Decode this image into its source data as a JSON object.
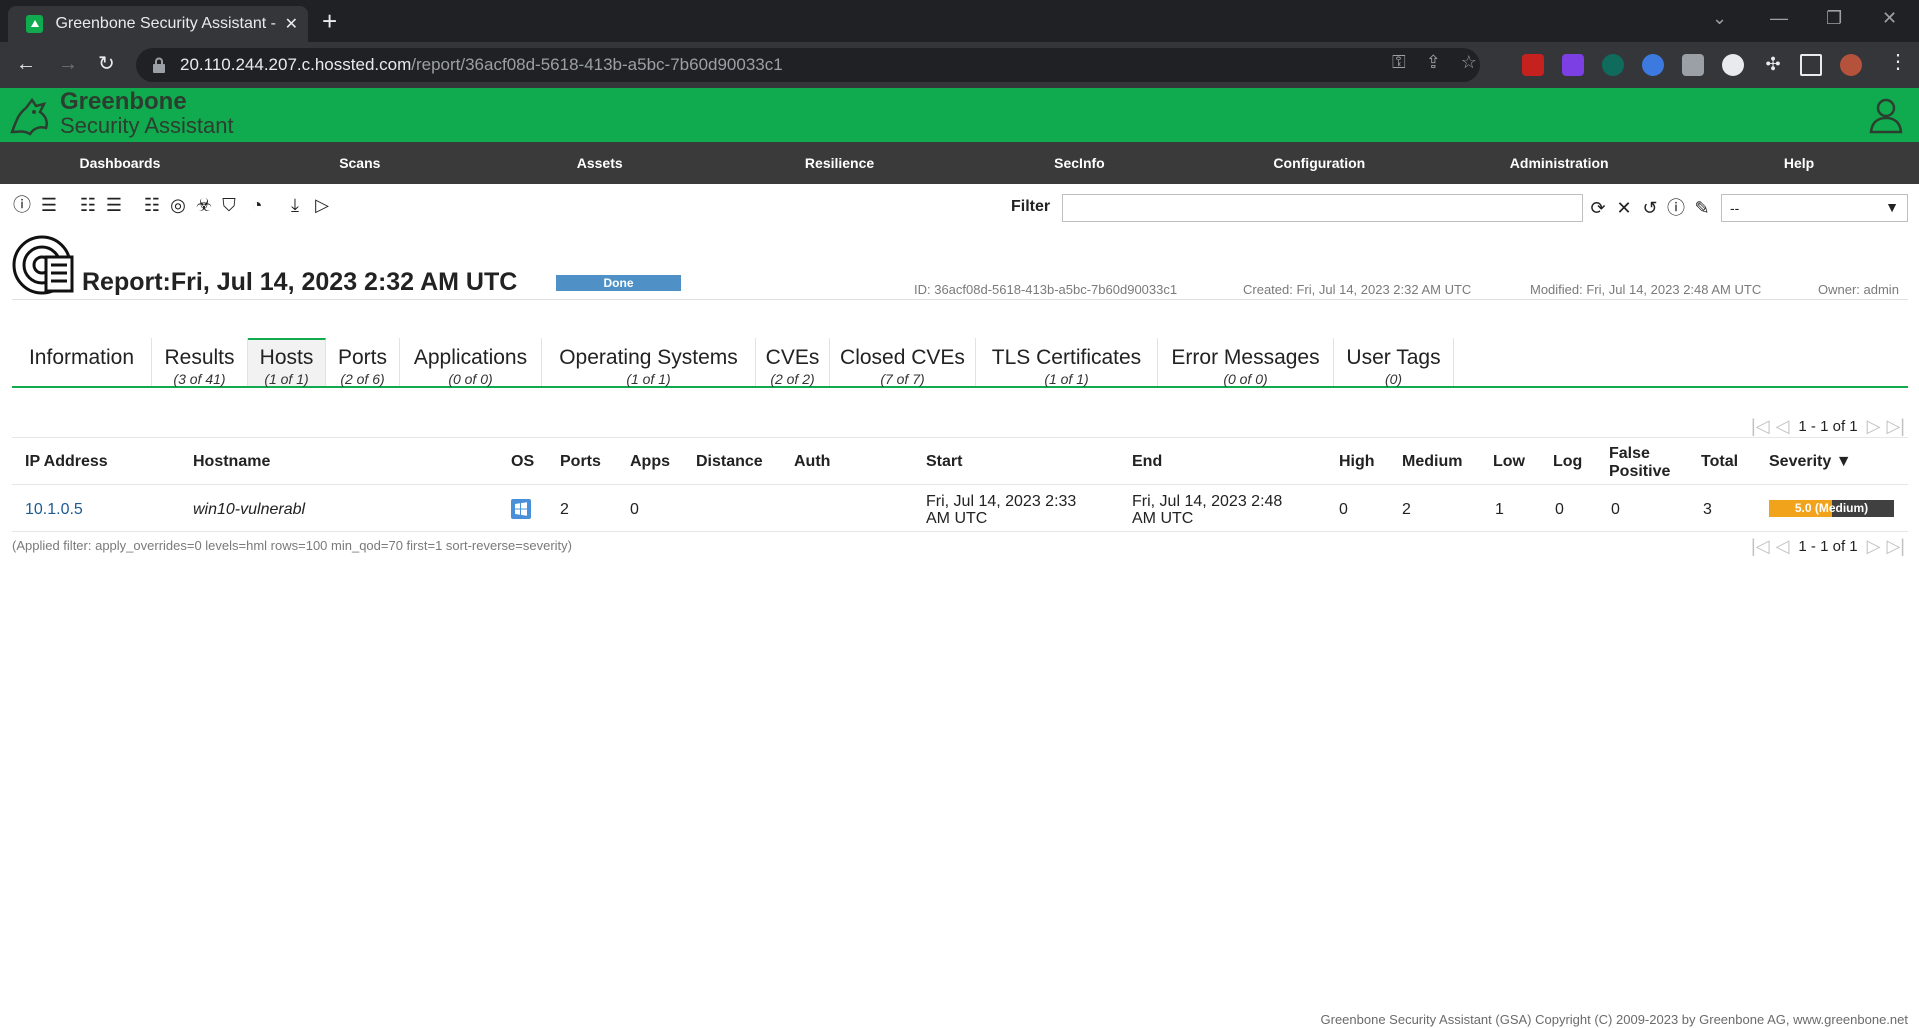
{
  "browser": {
    "tab_title": "Greenbone Security Assistant - Re",
    "url_host": "20.110.244.207.c.hossted.com",
    "url_path": "/report/36acf08d-5618-413b-a5bc-7b60d90033c1"
  },
  "app": {
    "brand_line1": "Greenbone",
    "brand_line2": "Security Assistant"
  },
  "menu": [
    {
      "label": "Dashboards"
    },
    {
      "label": "Scans"
    },
    {
      "label": "Assets"
    },
    {
      "label": "Resilience"
    },
    {
      "label": "SecInfo"
    },
    {
      "label": "Configuration"
    },
    {
      "label": "Administration"
    },
    {
      "label": "Help"
    }
  ],
  "filter": {
    "label": "Filter",
    "value": "",
    "select_value": "--"
  },
  "report": {
    "title": "Report:Fri, Jul 14, 2023 2:32 AM UTC",
    "status": "Done",
    "id": "ID: 36acf08d-5618-413b-a5bc-7b60d90033c1",
    "created": "Created: Fri, Jul 14, 2023 2:32 AM UTC",
    "modified": "Modified: Fri, Jul 14, 2023 2:48 AM UTC",
    "owner": "Owner: admin"
  },
  "tabs": [
    {
      "label": "Information",
      "count": ""
    },
    {
      "label": "Results",
      "count": "(3 of 41)"
    },
    {
      "label": "Hosts",
      "count": "(1 of 1)"
    },
    {
      "label": "Ports",
      "count": "(2 of 6)"
    },
    {
      "label": "Applications",
      "count": "(0 of 0)"
    },
    {
      "label": "Operating Systems",
      "count": "(1 of 1)"
    },
    {
      "label": "CVEs",
      "count": "(2 of 2)"
    },
    {
      "label": "Closed CVEs",
      "count": "(7 of 7)"
    },
    {
      "label": "TLS Certificates",
      "count": "(1 of 1)"
    },
    {
      "label": "Error Messages",
      "count": "(0 of 0)"
    },
    {
      "label": "User Tags",
      "count": "(0)"
    }
  ],
  "pagination": {
    "text": "1 - 1 of 1"
  },
  "table": {
    "headers": {
      "ip": "IP Address",
      "hostname": "Hostname",
      "os": "OS",
      "ports": "Ports",
      "apps": "Apps",
      "distance": "Distance",
      "auth": "Auth",
      "start": "Start",
      "end": "End",
      "high": "High",
      "medium": "Medium",
      "low": "Low",
      "log": "Log",
      "false_positive_1": "False",
      "false_positive_2": "Positive",
      "total": "Total",
      "severity": "Severity ▼"
    },
    "rows": [
      {
        "ip": "10.1.0.5",
        "hostname": "win10-vulnerabl",
        "os_icon": "windows-icon",
        "ports": "2",
        "apps": "0",
        "distance": "",
        "auth": "",
        "start_1": "Fri, Jul 14, 2023 2:33",
        "start_2": "AM UTC",
        "end_1": "Fri, Jul 14, 2023 2:48",
        "end_2": "AM UTC",
        "high": "0",
        "medium": "2",
        "low": "1",
        "log": "0",
        "false_positive": "0",
        "total": "3",
        "severity_label": "5.0 (Medium)",
        "severity_score": 5.0
      }
    ]
  },
  "applied_filter": "(Applied filter: apply_overrides=0 levels=hml rows=100 min_qod=70 first=1 sort-reverse=severity)",
  "footer": "Greenbone Security Assistant (GSA) Copyright (C) 2009-2023 by Greenbone AG, www.greenbone.net",
  "colors": {
    "brand_green": "#11ab4f",
    "menubar": "#3a3a3a",
    "status_done": "#4f91c7",
    "severity_medium": "#f0a31b"
  }
}
